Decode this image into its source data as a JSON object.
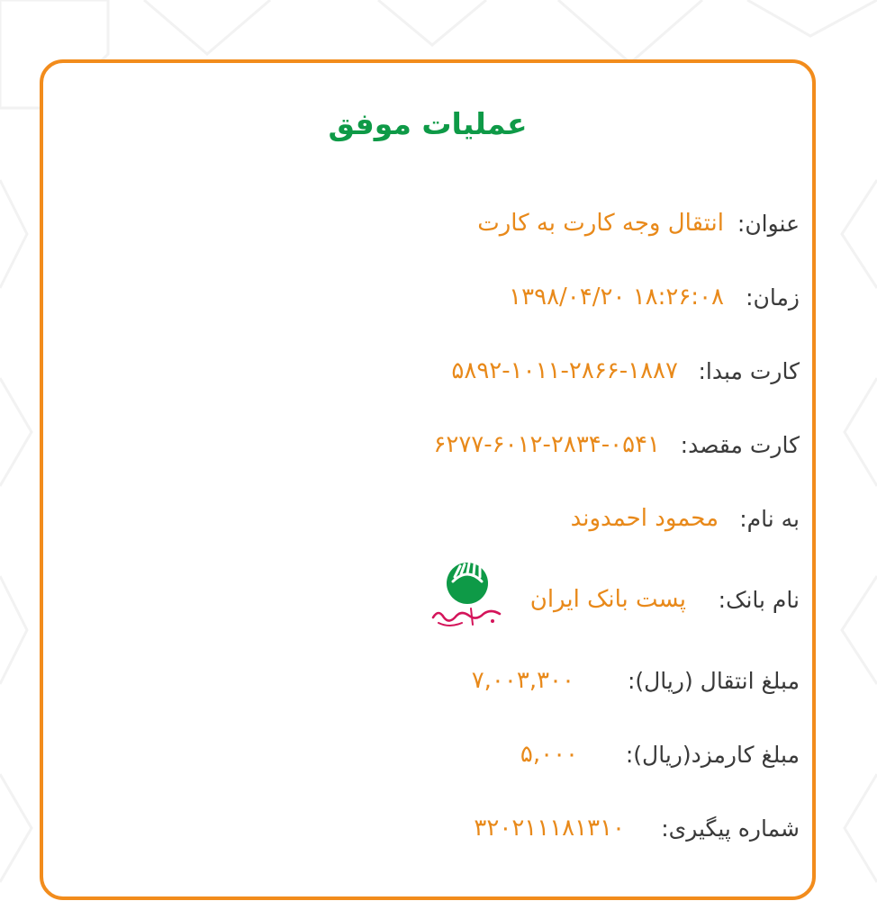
{
  "receipt": {
    "title": "عملیات موفق",
    "rows": [
      {
        "label": "عنوان:",
        "value": "انتقال وجه کارت به کارت"
      },
      {
        "label": "زمان:",
        "value": "۱۸:۲۶:۰۸ ۱۳۹۸/۰۴/۲۰"
      },
      {
        "label": "کارت مبدا:",
        "value": "۵۸۹۲-۱۰۱۱-۲۸۶۶-۱۸۸۷"
      },
      {
        "label": "کارت مقصد:",
        "value": "۶۲۷۷-۶۰۱۲-۲۸۳۴-۰۵۴۱"
      },
      {
        "label": "به نام:",
        "value": "محمود احمدوند"
      },
      {
        "label": "نام بانک:",
        "value": "پست بانک ایران"
      },
      {
        "label": "مبلغ انتقال (ریال):",
        "value": "۷,۰۰۳,۳۰۰"
      },
      {
        "label": "مبلغ کارمزد(ریال):",
        "value": "۵,۰۰۰"
      },
      {
        "label": "شماره پیگیری:",
        "value": "۳۲۰۲۱۱۱۸۱۳۱۰"
      }
    ],
    "bank_logo": {
      "icon": "post-bank-iran-logo",
      "logo_text": "پست بانک ایران",
      "color_green": "#0e9a47",
      "color_red": "#d4145a"
    }
  },
  "colors": {
    "accent_orange": "#f28c1c",
    "success_green": "#0e9a47",
    "value_orange": "#e8891a",
    "label_gray": "#3a3a3a"
  }
}
